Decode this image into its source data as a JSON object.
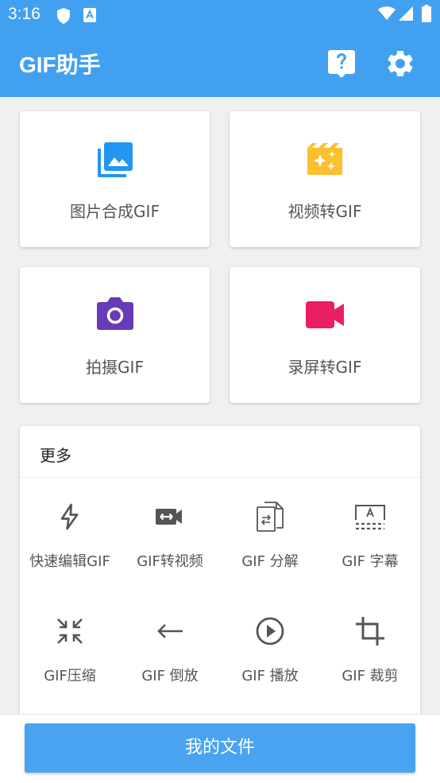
{
  "status_bar": {
    "time": "3:16"
  },
  "app_bar": {
    "title": "GIF助手"
  },
  "tiles": [
    {
      "label": "图片合成GIF",
      "icon": "photo-library-icon",
      "color": "#2196f3"
    },
    {
      "label": "视频转GIF",
      "icon": "movie-filter-icon",
      "color": "#fbc02d"
    },
    {
      "label": "拍摄GIF",
      "icon": "camera-icon",
      "color": "#673ab7"
    },
    {
      "label": "录屏转GIF",
      "icon": "videocam-icon",
      "color": "#e91e63"
    }
  ],
  "more": {
    "title": "更多",
    "items": [
      {
        "label": "快速编辑GIF",
        "icon": "flash-icon"
      },
      {
        "label": "GIF转视频",
        "icon": "video-convert-icon"
      },
      {
        "label": "GIF 分解",
        "icon": "split-file-icon"
      },
      {
        "label": "GIF 字幕",
        "icon": "subtitle-icon"
      },
      {
        "label": "GIF压缩",
        "icon": "compress-icon"
      },
      {
        "label": "GIF 倒放",
        "icon": "arrow-back-icon"
      },
      {
        "label": "GIF 播放",
        "icon": "play-circle-icon"
      },
      {
        "label": "GIF 裁剪",
        "icon": "crop-icon"
      }
    ]
  },
  "bottom": {
    "my_files_label": "我的文件"
  }
}
